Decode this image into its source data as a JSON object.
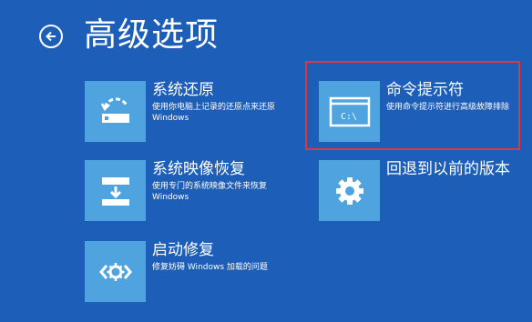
{
  "header": {
    "title": "高级选项",
    "back_icon": "back-arrow-circle-icon"
  },
  "options": [
    {
      "id": "system-restore",
      "icon": "restore-icon",
      "title": "系统还原",
      "desc": "使用你电脑上记录的还原点来还原 Windows"
    },
    {
      "id": "system-image-recovery",
      "icon": "image-recovery-icon",
      "title": "系统映像恢复",
      "desc": "使用专门的系统映像文件来恢复 Windows"
    },
    {
      "id": "startup-repair",
      "icon": "startup-repair-icon",
      "title": "启动修复",
      "desc": "修复妨碍 Windows 加载的问题"
    },
    {
      "id": "command-prompt",
      "icon": "command-prompt-icon",
      "title": "命令提示符",
      "desc": "使用命令提示符进行高级故障排除",
      "cmd_text": "C:\\"
    },
    {
      "id": "go-back",
      "icon": "gear-icon",
      "title": "回退到以前的版本",
      "desc": ""
    }
  ],
  "colors": {
    "background": "#1c5eb8",
    "tile": "#4fa3de",
    "highlight_border": "#e0373a",
    "text": "#ffffff"
  },
  "highlighted_option": "command-prompt"
}
